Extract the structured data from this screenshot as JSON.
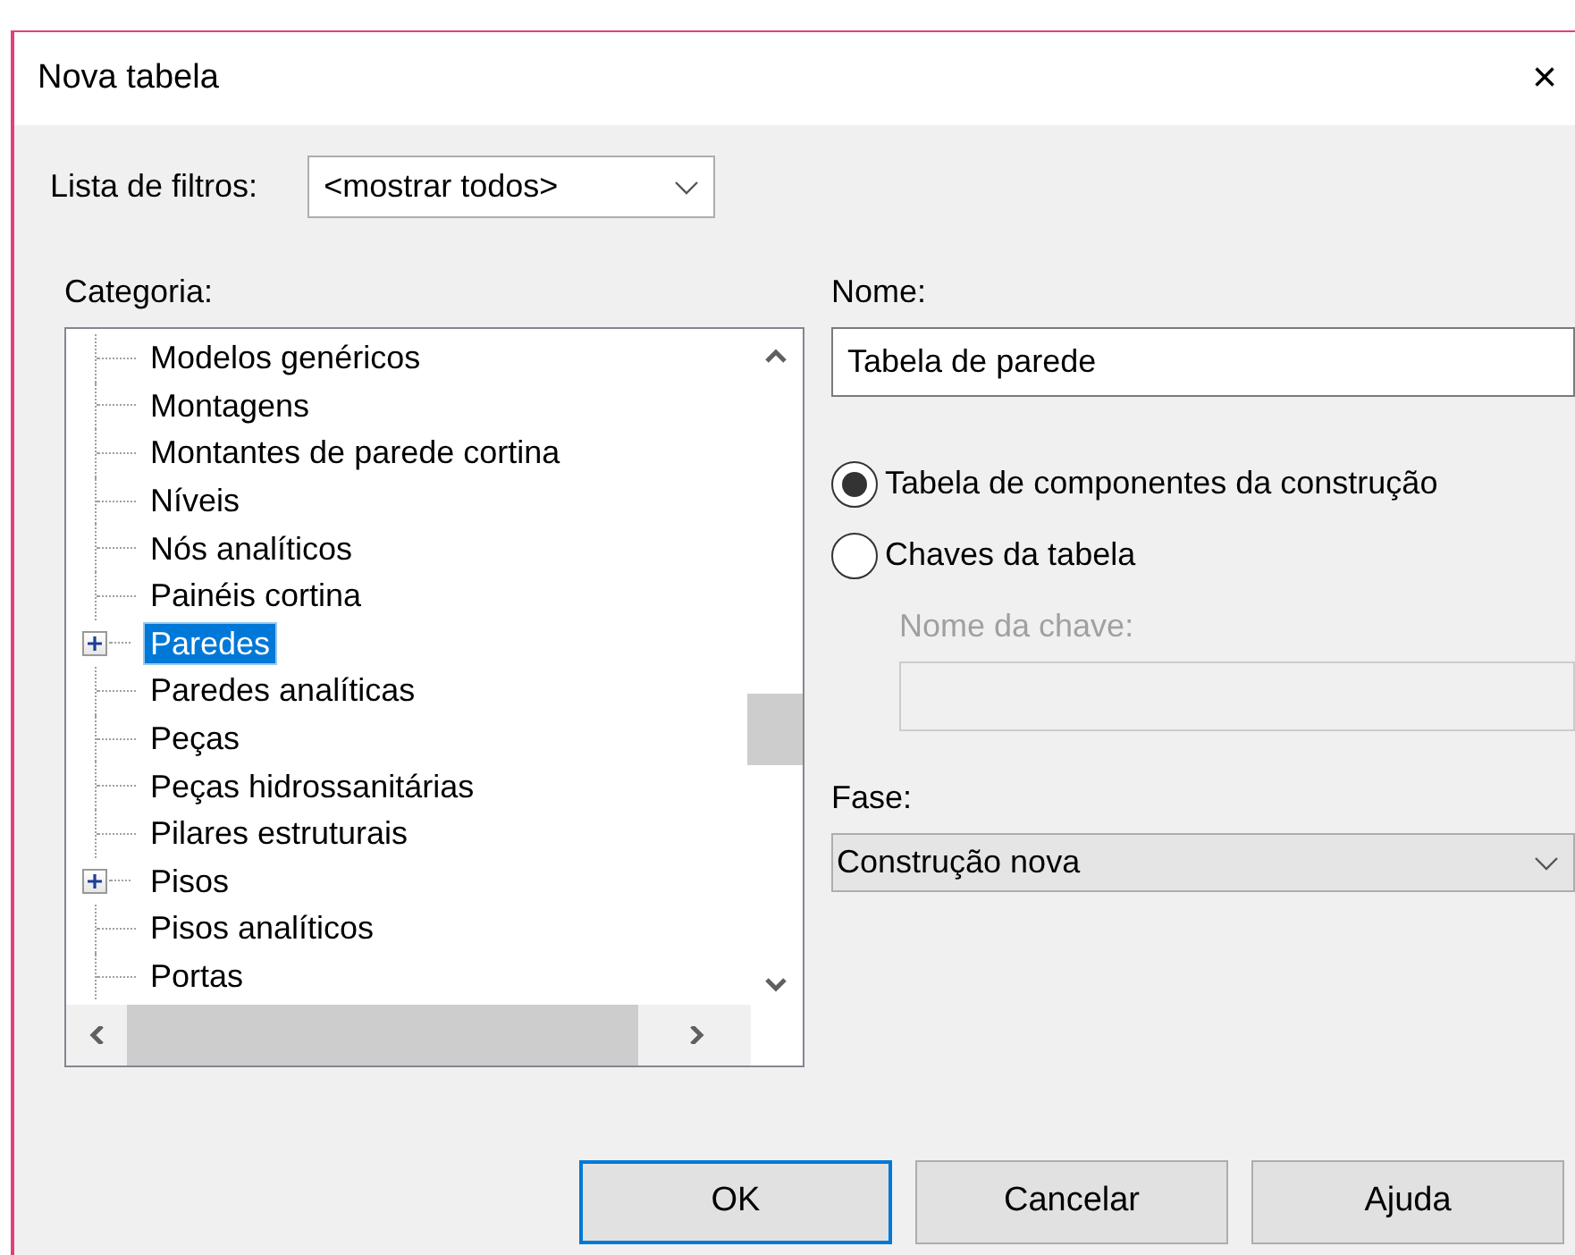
{
  "window": {
    "title": "Nova tabela",
    "close": "×"
  },
  "filter": {
    "label": "Lista de filtros:",
    "value": "<mostrar todos>"
  },
  "category": {
    "label": "Categoria:",
    "items": [
      {
        "label": "Modelos genéricos",
        "expandable": false,
        "selected": false
      },
      {
        "label": "Montagens",
        "expandable": false,
        "selected": false
      },
      {
        "label": "Montantes de parede cortina",
        "expandable": false,
        "selected": false
      },
      {
        "label": "Níveis",
        "expandable": false,
        "selected": false
      },
      {
        "label": "Nós analíticos",
        "expandable": false,
        "selected": false
      },
      {
        "label": "Painéis cortina",
        "expandable": false,
        "selected": false
      },
      {
        "label": "Paredes",
        "expandable": true,
        "selected": true
      },
      {
        "label": "Paredes analíticas",
        "expandable": false,
        "selected": false
      },
      {
        "label": "Peças",
        "expandable": false,
        "selected": false
      },
      {
        "label": "Peças hidrossanitárias",
        "expandable": false,
        "selected": false
      },
      {
        "label": "Pilares estruturais",
        "expandable": false,
        "selected": false
      },
      {
        "label": "Pisos",
        "expandable": true,
        "selected": false
      },
      {
        "label": "Pisos analíticos",
        "expandable": false,
        "selected": false
      },
      {
        "label": "Portas",
        "expandable": false,
        "selected": false
      }
    ]
  },
  "name": {
    "label": "Nome:",
    "value": "Tabela de parede"
  },
  "type_options": [
    {
      "label": "Tabela de componentes da construção",
      "selected": true
    },
    {
      "label": "Chaves da tabela",
      "selected": false
    }
  ],
  "key_name": {
    "label": "Nome da chave:",
    "disabled": true
  },
  "phase": {
    "label": "Fase:",
    "value": "Construção nova"
  },
  "buttons": [
    {
      "label": "OK",
      "default": true
    },
    {
      "label": "Cancelar",
      "default": false
    },
    {
      "label": "Ajuda",
      "default": false
    }
  ]
}
